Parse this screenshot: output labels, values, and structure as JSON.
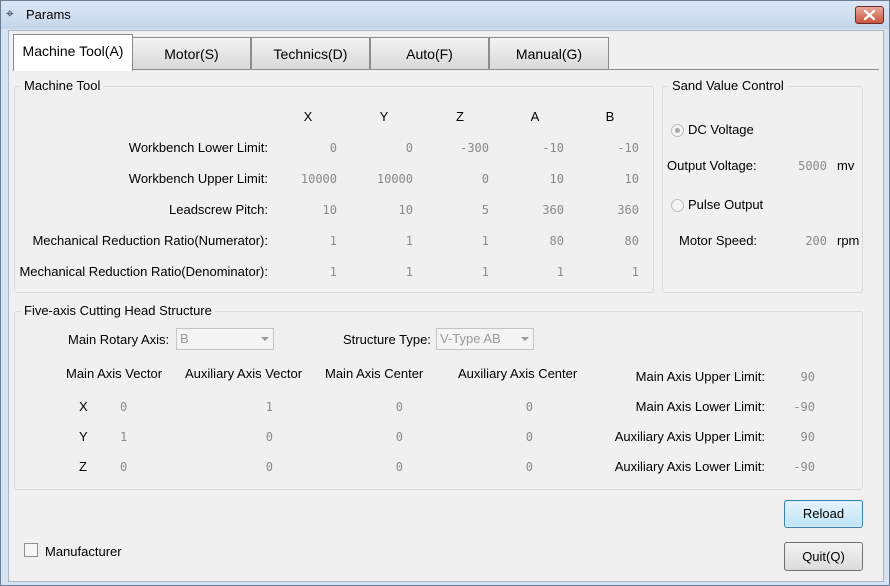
{
  "window": {
    "title": "Params",
    "app_icon": "app-icon",
    "close_icon": "close-icon"
  },
  "tabs": [
    "Machine Tool(A)",
    "Motor(S)",
    "Technics(D)",
    "Auto(F)",
    "Manual(G)"
  ],
  "machine_tool": {
    "title": "Machine Tool",
    "axes": [
      "X",
      "Y",
      "Z",
      "A",
      "B"
    ],
    "rows": [
      {
        "label": "Workbench Lower Limit:",
        "values": [
          "0",
          "0",
          "-300",
          "-10",
          "-10"
        ]
      },
      {
        "label": "Workbench Upper Limit:",
        "values": [
          "10000",
          "10000",
          "0",
          "10",
          "10"
        ]
      },
      {
        "label": "Leadscrew Pitch:",
        "values": [
          "10",
          "10",
          "5",
          "360",
          "360"
        ]
      },
      {
        "label": "Mechanical Reduction Ratio(Numerator):",
        "values": [
          "1",
          "1",
          "1",
          "80",
          "80"
        ]
      },
      {
        "label": "Mechanical Reduction Ratio(Denominator):",
        "values": [
          "1",
          "1",
          "1",
          "1",
          "1"
        ]
      }
    ]
  },
  "sand": {
    "title": "Sand Value Control",
    "dc_voltage": "DC Voltage",
    "output_voltage_label": "Output Voltage:",
    "output_voltage": "5000",
    "voltage_unit": "mv",
    "pulse_output": "Pulse Output",
    "motor_speed_label": "Motor Speed:",
    "motor_speed": "200",
    "speed_unit": "rpm"
  },
  "head": {
    "title": "Five-axis Cutting Head Structure",
    "main_rotary_label": "Main Rotary Axis:",
    "main_rotary_value": "B",
    "structure_label": "Structure Type:",
    "structure_value": "V-Type AB",
    "columns": [
      "Main Axis Vector",
      "Auxiliary Axis Vector",
      "Main Axis Center",
      "Auxiliary Axis Center"
    ],
    "rows": [
      {
        "axis": "X",
        "values": [
          "0",
          "1",
          "0",
          "0"
        ]
      },
      {
        "axis": "Y",
        "values": [
          "1",
          "0",
          "0",
          "0"
        ]
      },
      {
        "axis": "Z",
        "values": [
          "0",
          "0",
          "0",
          "0"
        ]
      }
    ],
    "limits": [
      {
        "label": "Main Axis Upper Limit:",
        "value": "90"
      },
      {
        "label": "Main Axis Lower Limit:",
        "value": "-90"
      },
      {
        "label": "Auxiliary Axis Upper Limit:",
        "value": "90"
      },
      {
        "label": "Auxiliary Axis Lower Limit:",
        "value": "-90"
      }
    ]
  },
  "footer": {
    "manufacturer": "Manufacturer",
    "reload": "Reload",
    "quit": "Quit(Q)"
  }
}
